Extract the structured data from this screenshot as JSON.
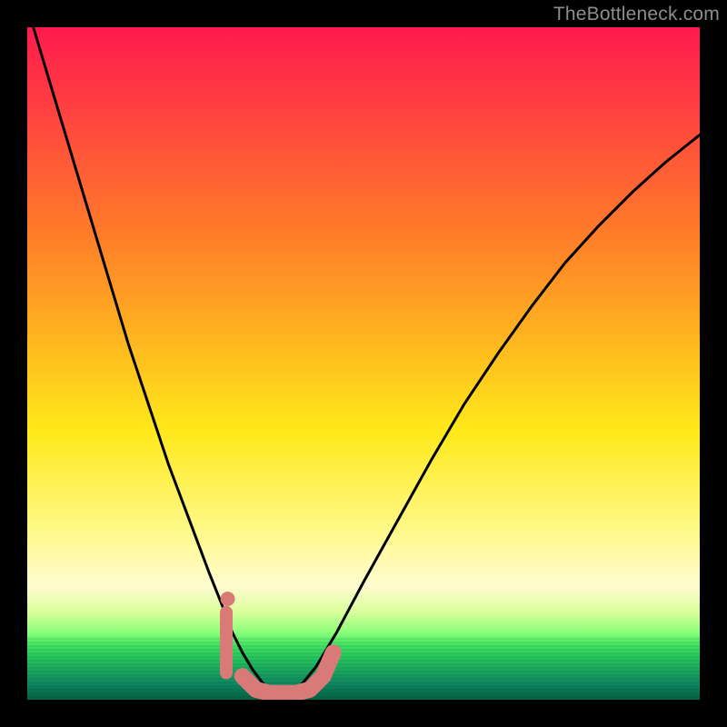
{
  "watermark": "TheBottleneck.com",
  "colors": {
    "frame": "#000000",
    "curve": "#000000",
    "marker": "#d97a78",
    "watermark": "#8d8d8d"
  },
  "chart_data": {
    "type": "line",
    "title": "",
    "xlabel": "",
    "ylabel": "",
    "xlim": [
      0,
      1
    ],
    "ylim": [
      0,
      1
    ],
    "axes_visible": false,
    "grid": false,
    "background_gradient": {
      "direction": "vertical",
      "stops": [
        {
          "pos": 0.0,
          "color": "#ff1a4d"
        },
        {
          "pos": 0.3,
          "color": "#ff7a2a"
        },
        {
          "pos": 0.6,
          "color": "#ffe91a"
        },
        {
          "pos": 0.83,
          "color": "#fffcd0"
        },
        {
          "pos": 0.9,
          "color": "#8aff7a"
        },
        {
          "pos": 1.0,
          "color": "#087050"
        }
      ]
    },
    "series": [
      {
        "name": "bottleneck-curve",
        "style": "line",
        "stroke": "#000000",
        "stroke_width": 3,
        "x": [
          0.0,
          0.03,
          0.06,
          0.09,
          0.12,
          0.15,
          0.18,
          0.21,
          0.24,
          0.27,
          0.29,
          0.305,
          0.32,
          0.335,
          0.35,
          0.365,
          0.38,
          0.395,
          0.41,
          0.43,
          0.46,
          0.5,
          0.55,
          0.6,
          0.65,
          0.7,
          0.75,
          0.8,
          0.85,
          0.9,
          0.95,
          1.0
        ],
        "y": [
          1.03,
          0.93,
          0.83,
          0.73,
          0.63,
          0.53,
          0.44,
          0.35,
          0.27,
          0.19,
          0.14,
          0.1,
          0.07,
          0.045,
          0.025,
          0.012,
          0.01,
          0.012,
          0.025,
          0.05,
          0.1,
          0.175,
          0.265,
          0.355,
          0.44,
          0.515,
          0.585,
          0.65,
          0.705,
          0.755,
          0.8,
          0.84
        ]
      },
      {
        "name": "highlight-left-vertical",
        "style": "marker-line",
        "stroke": "#d97a78",
        "stroke_width": 14,
        "x": [
          0.296,
          0.296
        ],
        "y": [
          0.13,
          0.04
        ]
      },
      {
        "name": "highlight-left-dot",
        "style": "marker-dot",
        "fill": "#d97a78",
        "radius": 8,
        "x": [
          0.298
        ],
        "y": [
          0.15
        ]
      },
      {
        "name": "highlight-bottom-u",
        "style": "marker-line",
        "stroke": "#d97a78",
        "stroke_width": 18,
        "x": [
          0.32,
          0.34,
          0.36,
          0.38,
          0.4,
          0.42,
          0.44,
          0.455
        ],
        "y": [
          0.035,
          0.015,
          0.01,
          0.01,
          0.01,
          0.015,
          0.035,
          0.07
        ]
      }
    ]
  }
}
